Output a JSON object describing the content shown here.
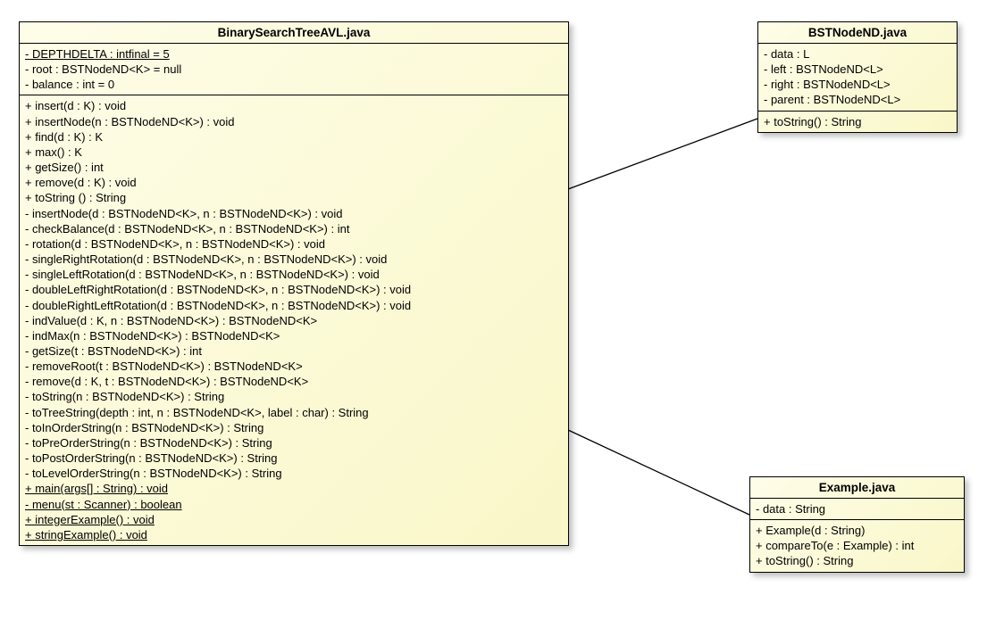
{
  "classes": {
    "bst_avl": {
      "title": "BinarySearchTreeAVL.java",
      "attributes": [
        {
          "text": "- DEPTHDELTA : intfinal = 5",
          "static": true
        },
        {
          "text": "- root : BSTNodeND<K> = null",
          "static": false
        },
        {
          "text": "- balance : int = 0",
          "static": false
        }
      ],
      "operations": [
        {
          "text": "+ insert(d : K) : void",
          "static": false
        },
        {
          "text": "+ insertNode(n : BSTNodeND<K>) : void",
          "static": false
        },
        {
          "text": "+ find(d : K) : K",
          "static": false
        },
        {
          "text": "+ max() : K",
          "static": false
        },
        {
          "text": "+ getSize() : int",
          "static": false
        },
        {
          "text": "+ remove(d : K) : void",
          "static": false
        },
        {
          "text": "+ toString () : String",
          "static": false
        },
        {
          "text": "- insertNode(d : BSTNodeND<K>, n : BSTNodeND<K>) : void",
          "static": false
        },
        {
          "text": "- checkBalance(d : BSTNodeND<K>, n : BSTNodeND<K>) : int",
          "static": false
        },
        {
          "text": "- rotation(d : BSTNodeND<K>, n : BSTNodeND<K>) : void",
          "static": false
        },
        {
          "text": "- singleRightRotation(d : BSTNodeND<K>, n : BSTNodeND<K>) : void",
          "static": false
        },
        {
          "text": "- singleLeftRotation(d : BSTNodeND<K>, n : BSTNodeND<K>) : void",
          "static": false
        },
        {
          "text": "- doubleLeftRightRotation(d : BSTNodeND<K>, n : BSTNodeND<K>) : void",
          "static": false
        },
        {
          "text": "- doubleRightLeftRotation(d : BSTNodeND<K>, n : BSTNodeND<K>) : void",
          "static": false
        },
        {
          "text": "- indValue(d : K, n : BSTNodeND<K>) : BSTNodeND<K>",
          "static": false
        },
        {
          "text": "- indMax(n : BSTNodeND<K>) : BSTNodeND<K>",
          "static": false
        },
        {
          "text": "- getSize(t : BSTNodeND<K>) : int",
          "static": false
        },
        {
          "text": "- removeRoot(t : BSTNodeND<K>) : BSTNodeND<K>",
          "static": false
        },
        {
          "text": "- remove(d : K, t : BSTNodeND<K>) : BSTNodeND<K>",
          "static": false
        },
        {
          "text": "- toString(n : BSTNodeND<K>) : String",
          "static": false
        },
        {
          "text": "- toTreeString(depth : int, n : BSTNodeND<K>, label : char) : String",
          "static": false
        },
        {
          "text": "- toInOrderString(n : BSTNodeND<K>) : String",
          "static": false
        },
        {
          "text": "- toPreOrderString(n : BSTNodeND<K>) : String",
          "static": false
        },
        {
          "text": "- toPostOrderString(n : BSTNodeND<K>) : String",
          "static": false
        },
        {
          "text": "- toLevelOrderString(n : BSTNodeND<K>) : String",
          "static": false
        },
        {
          "text": "+ main(args[] : String) : void",
          "static": true
        },
        {
          "text": "- menu(st : Scanner) : boolean",
          "static": true
        },
        {
          "text": "+ integerExample() : void",
          "static": true
        },
        {
          "text": "+ stringExample() : void",
          "static": true
        }
      ]
    },
    "bst_node": {
      "title": "BSTNodeND.java",
      "attributes": [
        {
          "text": "- data : L",
          "static": false
        },
        {
          "text": "- left : BSTNodeND<L>",
          "static": false
        },
        {
          "text": "- right : BSTNodeND<L>",
          "static": false
        },
        {
          "text": "- parent : BSTNodeND<L>",
          "static": false
        }
      ],
      "operations": [
        {
          "text": "+ toString() : String",
          "static": false
        }
      ]
    },
    "example": {
      "title": "Example.java",
      "attributes": [
        {
          "text": "- data : String",
          "static": false
        }
      ],
      "operations": [
        {
          "text": "+ Example(d : String)",
          "static": false
        },
        {
          "text": "+ compareTo(e : Example) : int",
          "static": false
        },
        {
          "text": "+ toString() : String",
          "static": false
        }
      ]
    }
  }
}
